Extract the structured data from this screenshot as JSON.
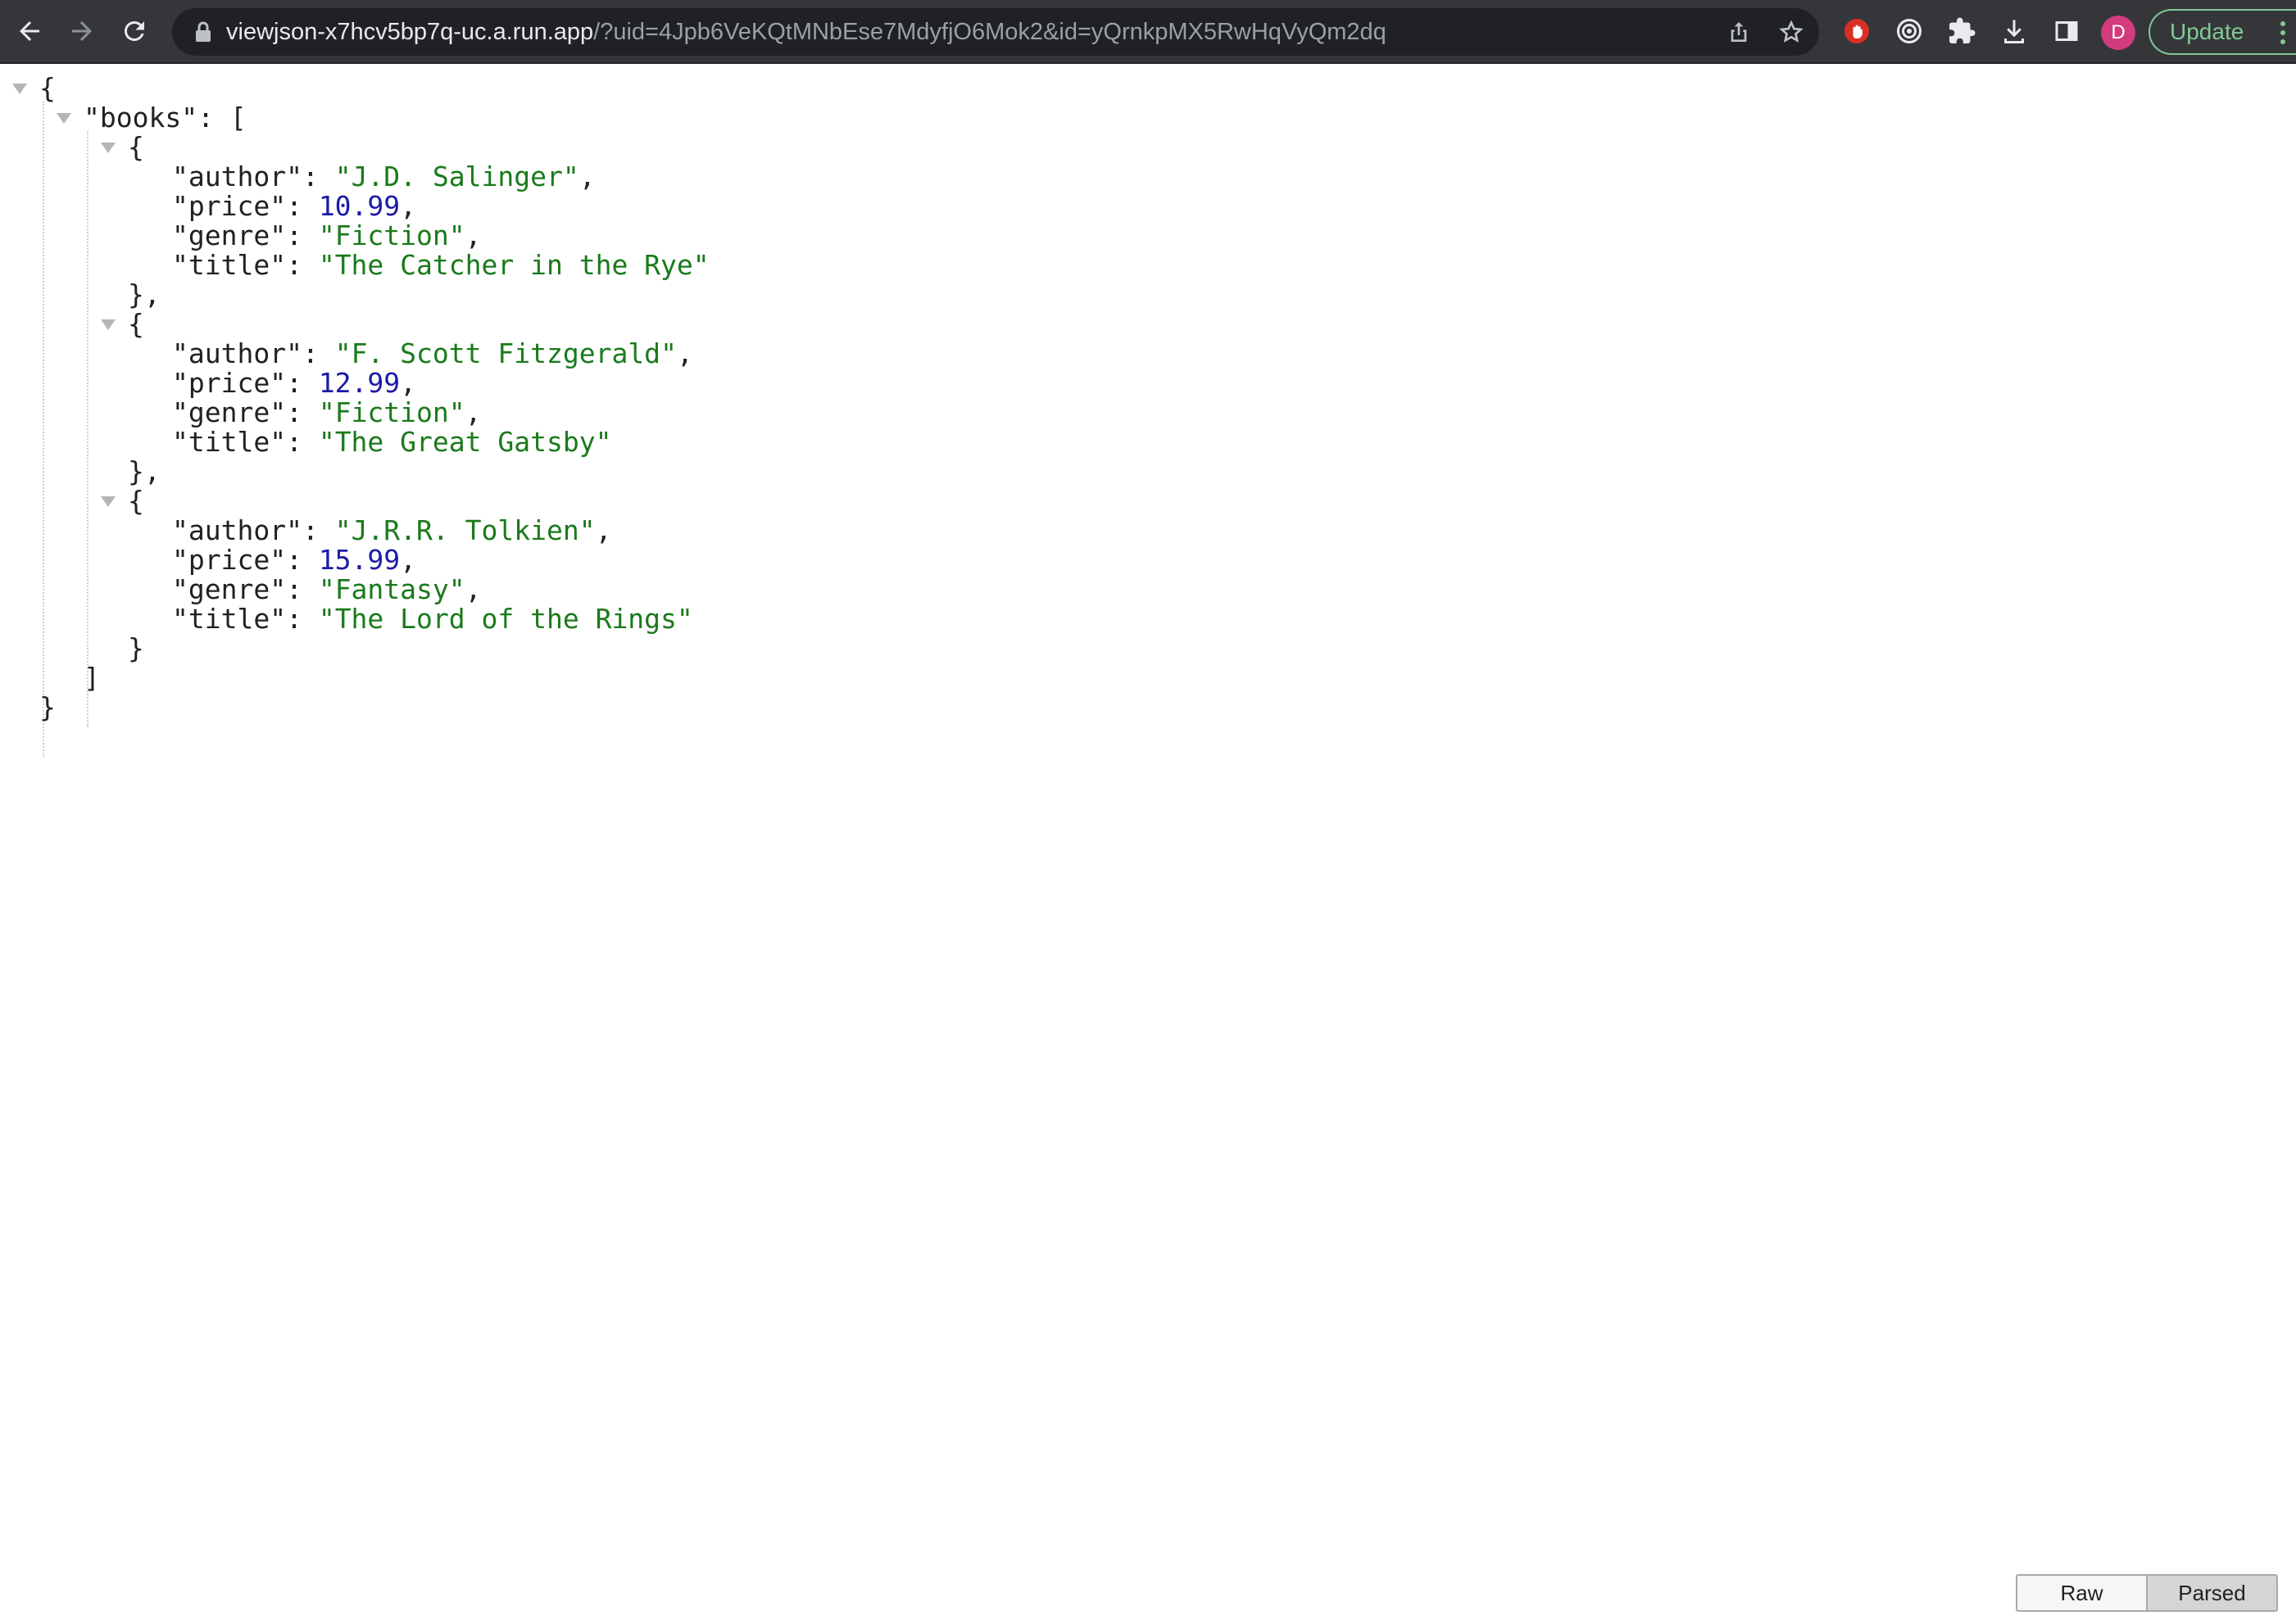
{
  "browser": {
    "url_host": "viewjson-x7hcv5bp7q-uc.a.run.app",
    "url_path": "/?uid=4Jpb6VeKQtMNbEse7MdyfjO6Mok2&id=yQrnkpMX5RwHqVyQm2dq",
    "profile_initial": "D",
    "update_label": "Update",
    "icons": [
      "back-icon",
      "forward-icon",
      "reload-icon",
      "lock-icon",
      "share-icon",
      "bookmark-star-icon",
      "extension-stop-icon",
      "extension-target-icon",
      "extensions-puzzle-icon",
      "download-icon",
      "side-panel-icon",
      "menu-dots-icon"
    ],
    "accent_color": "#81c995"
  },
  "json": {
    "root_key": "books",
    "books": [
      {
        "author": "J.D. Salinger",
        "price": "10.99",
        "genre": "Fiction",
        "title": "The Catcher in the Rye"
      },
      {
        "author": "F. Scott Fitzgerald",
        "price": "12.99",
        "genre": "Fiction",
        "title": "The Great Gatsby"
      },
      {
        "author": "J.R.R. Tolkien",
        "price": "15.99",
        "genre": "Fantasy",
        "title": "The Lord of the Rings"
      }
    ],
    "field_order": [
      "author",
      "price",
      "genre",
      "title"
    ],
    "string_color": "#1a7a1a",
    "number_color": "#1a1aa6"
  },
  "view_toggle": {
    "raw_label": "Raw",
    "parsed_label": "Parsed",
    "selected": "Parsed"
  }
}
